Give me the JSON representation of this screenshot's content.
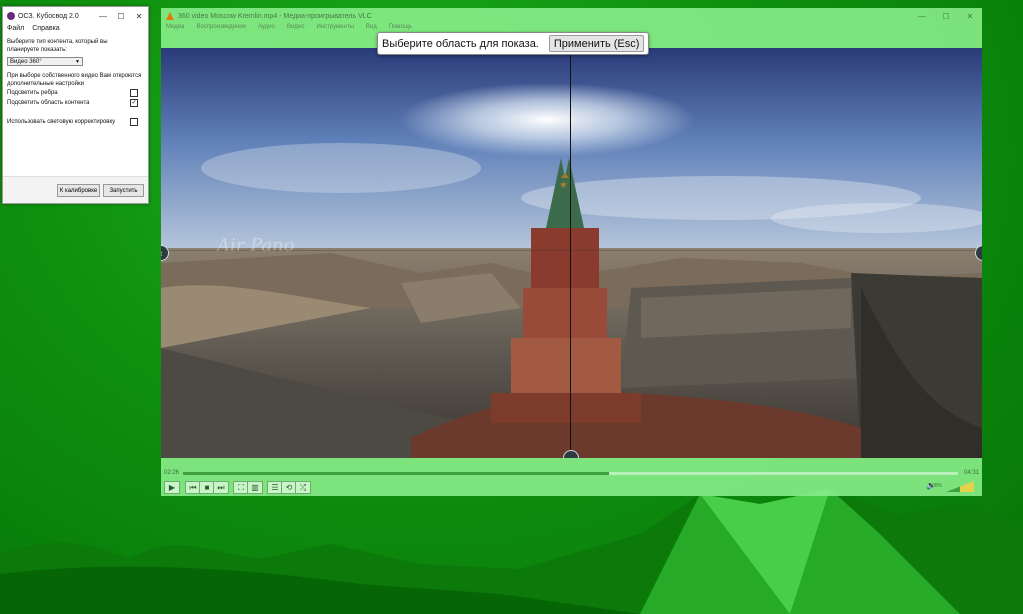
{
  "tool_window": {
    "title": "ОСЗ. Кубосвод 2.0",
    "window_controls": [
      "—",
      "☐",
      "✕"
    ],
    "menu": [
      "Файл",
      "Справка"
    ],
    "prompt_line1": "Выберите тип контента, который вы",
    "prompt_line2": "планируете показать:",
    "content_type_value": "Видео 360°",
    "note_line1": "При выборе собственного видео Вам откроются",
    "note_line2": "дополнительные настройки",
    "options": [
      {
        "label": "Подсветить ребра",
        "checked": false
      },
      {
        "label": "Подсветить область контента",
        "checked": true
      },
      {
        "label": "Использовать световую корректировку",
        "checked": false
      }
    ],
    "calibration_button": "К калибровке",
    "launch_button": "Запустить"
  },
  "media_player": {
    "title": "360 video Moscow Kremlin.mp4 - Медиа-проигрыватель VLC",
    "window_controls": [
      "—",
      "☐",
      "✕"
    ],
    "menu": [
      "Медиа",
      "Воспроизведение",
      "Аудио",
      "Видео",
      "Инструменты",
      "Вид",
      "Помощь"
    ],
    "watermark": "Air Pano",
    "current_time": "02:26",
    "total_time": "04:31",
    "progress": 0.55,
    "volume_percent": "100%"
  },
  "overlay_prompt": {
    "text": "Выберите область для показа.",
    "apply_button": "Применить (Esc)"
  },
  "icons": {
    "play": "▶",
    "prev": "⏮",
    "stop": "■",
    "next": "⏭",
    "fullscreen": "⛶",
    "extended": "▥",
    "playlist": "☰",
    "loop": "⟲",
    "shuffle": "⤮",
    "speaker": "🔈",
    "left": "‹",
    "right": "›",
    "down": "⌄"
  },
  "colors": {
    "desktop_green": "#0e8f0e",
    "overlay_green": "#87eb87",
    "vlc_orange": "#e07a10"
  }
}
